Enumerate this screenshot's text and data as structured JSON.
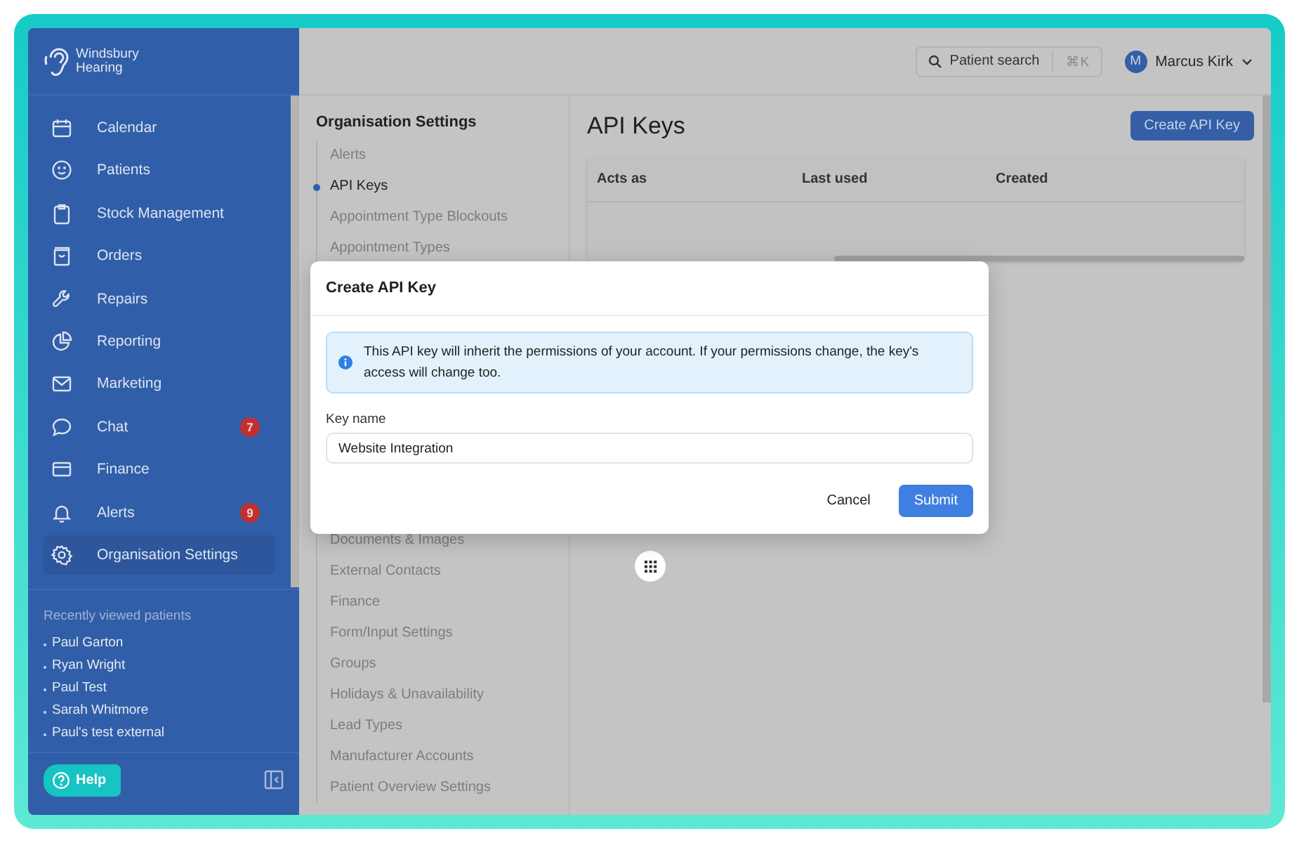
{
  "brand": {
    "name": "Windsbury Hearing"
  },
  "sidebar": {
    "items": [
      {
        "label": "Calendar",
        "selected": false
      },
      {
        "label": "Patients",
        "selected": false
      },
      {
        "label": "Stock Management",
        "selected": false
      },
      {
        "label": "Orders",
        "selected": false
      },
      {
        "label": "Repairs",
        "selected": false
      },
      {
        "label": "Reporting",
        "selected": false
      },
      {
        "label": "Marketing",
        "selected": false
      },
      {
        "label": "Chat",
        "selected": false,
        "badge": "7"
      },
      {
        "label": "Finance",
        "selected": false
      },
      {
        "label": "Alerts",
        "selected": false,
        "badge": "9"
      },
      {
        "label": "Organisation Settings",
        "selected": true
      }
    ],
    "recent": {
      "title": "Recently viewed patients",
      "patients": [
        "Paul Garton",
        "Ryan Wright",
        "Paul Test",
        "Sarah Whitmore",
        "Paul's test external"
      ]
    },
    "help_button": "Help"
  },
  "top_bar": {
    "search": {
      "placeholder": "Patient search",
      "shortcut": "⌘K"
    },
    "user": {
      "initial": "M",
      "name": "Marcus Kirk"
    }
  },
  "settings_nav": {
    "title": "Organisation Settings",
    "items": [
      {
        "label": "Alerts",
        "selected": false
      },
      {
        "label": "API Keys",
        "selected": true
      },
      {
        "label": "Appointment Type Blockouts",
        "selected": false
      },
      {
        "label": "Appointment Types",
        "selected": false
      },
      {
        "label": "Documents & Images",
        "selected": false
      },
      {
        "label": "External Contacts",
        "selected": false
      },
      {
        "label": "Finance",
        "selected": false
      },
      {
        "label": "Form/Input Settings",
        "selected": false
      },
      {
        "label": "Groups",
        "selected": false
      },
      {
        "label": "Holidays & Unavailability",
        "selected": false
      },
      {
        "label": "Lead Types",
        "selected": false
      },
      {
        "label": "Manufacturer Accounts",
        "selected": false
      },
      {
        "label": "Patient Overview Settings",
        "selected": false
      }
    ]
  },
  "page": {
    "title": "API Keys",
    "create_button": "Create API Key",
    "table": {
      "columns": [
        "Acts as",
        "Last used",
        "Created"
      ]
    }
  },
  "modal": {
    "title": "Create API Key",
    "info": "This API key will inherit the permissions of your account. If your permissions change, the key's access will change too.",
    "field": {
      "label": "Key name",
      "value": "Website Integration"
    },
    "buttons": {
      "cancel": "Cancel",
      "submit": "Submit"
    }
  }
}
